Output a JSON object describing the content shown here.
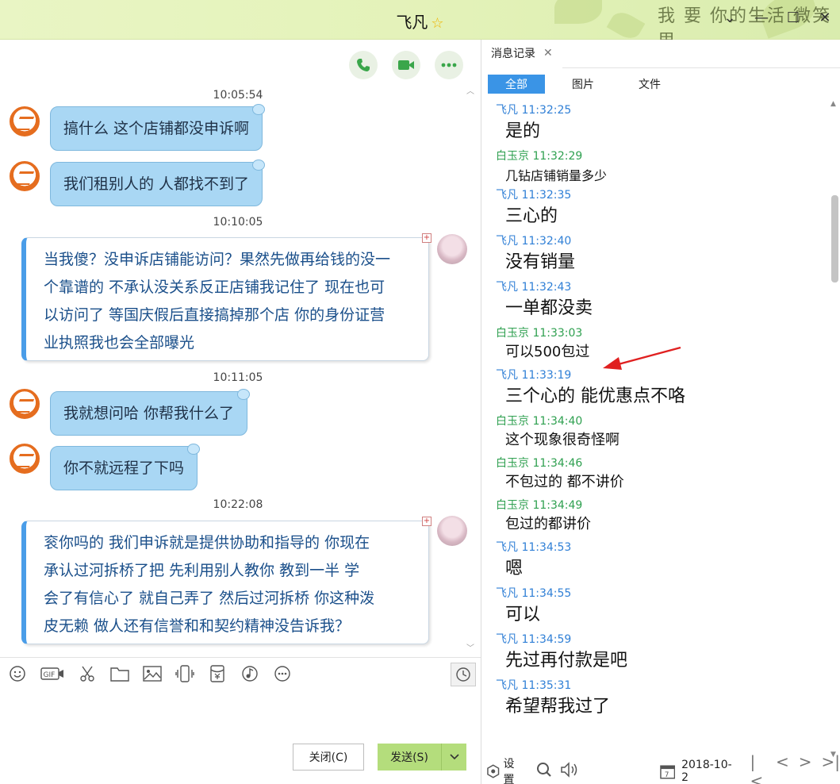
{
  "window": {
    "title": "飞凡",
    "deco_text": "我 要 你的生活  微笑里",
    "controls": [
      "minimize-icon",
      "restore-icon",
      "maximize-icon",
      "close-icon"
    ]
  },
  "chat": {
    "tools": [
      "phone-icon",
      "video-icon",
      "more-icon"
    ],
    "messages": [
      {
        "time": "10:05:54"
      },
      {
        "from": "other",
        "text": "搞什么  这个店铺都没申诉啊"
      },
      {
        "from": "other",
        "text": "我们租别人的  人都找不到了"
      },
      {
        "time": "10:10:05"
      },
      {
        "from": "self",
        "lines": [
          "当我傻？没申诉店铺能访问？果然先做再给钱的没一",
          "个靠谱的     不承认没关系反正店铺我记住了 现在也可",
          "以访问了  等国庆假后直接搞掉那个店  你的身份证营",
          "业执照我也会全部曝光"
        ]
      },
      {
        "time": "10:11:05"
      },
      {
        "from": "other",
        "text": "我就想问哈 你帮我什么了"
      },
      {
        "from": "other",
        "text": "你不就远程了下吗"
      },
      {
        "time": "10:22:08"
      },
      {
        "from": "self",
        "lines": [
          "衮你吗的  我们申诉就是提供协助和指导的     你现在",
          "承认过河拆桥了把      先利用别人教你  教到一半  学",
          "会了有信心了 就自己弄了  然后过河拆桥    你这种泼",
          "皮无赖 做人还有信誉和和契约精神没告诉我？"
        ]
      }
    ]
  },
  "input": {
    "tools": [
      "emoji-icon",
      "gif-icon",
      "scissors-icon",
      "folder-icon",
      "image-icon",
      "shake-icon",
      "red-packet-icon",
      "music-icon",
      "more-icon"
    ],
    "close_label": "关闭(C)",
    "send_label": "发送(S)"
  },
  "record": {
    "tab_label": "消息记录",
    "filters": [
      "全部",
      "图片",
      "文件"
    ],
    "active_filter": "全部",
    "entries": [
      {
        "sender": "飞凡",
        "time": "11:32:25",
        "side": "self",
        "text": "是的",
        "size": "big"
      },
      {
        "sender": "白玉京",
        "time": "11:32:29",
        "side": "other",
        "text": "几钻店铺销量多少",
        "size": "xs"
      },
      {
        "sender": "飞凡",
        "time": "11:32:35",
        "side": "self",
        "text": "三心的",
        "size": "big"
      },
      {
        "sender": "飞凡",
        "time": "11:32:40",
        "side": "self",
        "text": "没有销量",
        "size": "big"
      },
      {
        "sender": "飞凡",
        "time": "11:32:43",
        "side": "self",
        "text": "一单都没卖",
        "size": "big"
      },
      {
        "sender": "白玉京",
        "time": "11:33:03",
        "side": "other",
        "text": "可以500包过",
        "size": "sm"
      },
      {
        "sender": "飞凡",
        "time": "11:33:19",
        "side": "self",
        "text": "三个心的 能优惠点不咯",
        "size": "big"
      },
      {
        "sender": "白玉京",
        "time": "11:34:40",
        "side": "other",
        "text": "这个现象很奇怪啊",
        "size": "sm"
      },
      {
        "sender": "白玉京",
        "time": "11:34:46",
        "side": "other",
        "text": "不包过的 都不讲价",
        "size": "sm"
      },
      {
        "sender": "白玉京",
        "time": "11:34:49",
        "side": "other",
        "text": "包过的都讲价",
        "size": "sm"
      },
      {
        "sender": "飞凡",
        "time": "11:34:53",
        "side": "self",
        "text": "嗯",
        "size": "big"
      },
      {
        "sender": "飞凡",
        "time": "11:34:55",
        "side": "self",
        "text": "可以",
        "size": "big"
      },
      {
        "sender": "飞凡",
        "time": "11:34:59",
        "side": "self",
        "text": "先过再付款是吧",
        "size": "big"
      },
      {
        "sender": "飞凡",
        "time": "11:35:31",
        "side": "self",
        "text": "希望帮我过了",
        "size": "big"
      }
    ],
    "bottom": {
      "settings_label": "设置",
      "date": "2018-10-2"
    }
  },
  "colors": {
    "titlebar": "#e6f3bd",
    "bubble_in": "#a9d7f4",
    "bubble_out_border": "#4a9de8",
    "self_name": "#2f7fd6",
    "other_name": "#2fa050",
    "send_button": "#b4dd7c",
    "active_filter": "#3a94e6",
    "annotation_arrow": "#e02020"
  }
}
